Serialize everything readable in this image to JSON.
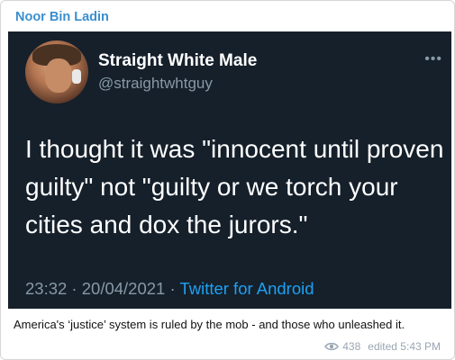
{
  "channel": {
    "author_name": "Noor Bin Ladin"
  },
  "tweet": {
    "display_name": "Straight White Male",
    "handle": "@straightwhtguy",
    "more_label": "•••",
    "text": "I thought it was \"innocent until proven guilty\" not \"guilty or we torch your cities and dox the jurors.\"",
    "timestamp": "23:32 · 20/04/2021",
    "separator": " · ",
    "source": "Twitter for Android"
  },
  "post": {
    "caption": "America's ‘justice’ system is ruled by the mob - and those who unleashed it.",
    "views": "438",
    "edited_label": "edited 5:43 PM"
  },
  "colors": {
    "author": "#3a8fd0",
    "tweet_bg": "#15202b",
    "link": "#1da1f2",
    "muted": "#8899a6"
  },
  "icons": {
    "views": "eye-icon",
    "menu": "more-options-icon"
  }
}
